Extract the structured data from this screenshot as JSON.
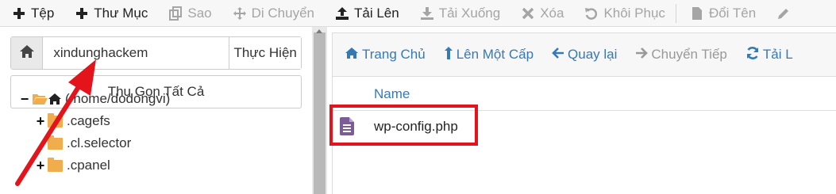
{
  "toolbar": {
    "items": [
      {
        "label": "Tệp",
        "icon": "plus-icon",
        "state": "active"
      },
      {
        "label": "Thư Mục",
        "icon": "plus-icon",
        "state": "active"
      },
      {
        "label": "Sao",
        "icon": "copy-icon",
        "state": "disabled"
      },
      {
        "label": "Di Chuyển",
        "icon": "move-icon",
        "state": "disabled"
      },
      {
        "label": "Tải Lên",
        "icon": "upload-icon",
        "state": "active"
      },
      {
        "label": "Tải Xuống",
        "icon": "download-icon",
        "state": "disabled"
      },
      {
        "label": "Xóa",
        "icon": "close-icon",
        "state": "disabled"
      },
      {
        "label": "Khôi Phục",
        "icon": "undo-icon",
        "state": "disabled"
      },
      {
        "label": "Đổi Tên",
        "icon": "file-icon",
        "state": "disabled"
      }
    ]
  },
  "sidebar": {
    "path_value": "xindunghackem",
    "go_label": "Thực Hiện",
    "collapse_label": "Thu Gọn Tất Cả",
    "tree": [
      {
        "label": "(/home/dodongvi)",
        "toggle": "−",
        "type": "root"
      },
      {
        "label": ".cagefs",
        "toggle": "+",
        "type": "folder"
      },
      {
        "label": ".cl.selector",
        "toggle": "",
        "type": "folder"
      },
      {
        "label": ".cpanel",
        "toggle": "+",
        "type": "folder"
      }
    ]
  },
  "navbar": {
    "items": [
      {
        "label": "Trang Chủ",
        "icon": "home-icon",
        "state": "enabled"
      },
      {
        "label": "Lên Một Cấp",
        "icon": "level-up-icon",
        "state": "enabled"
      },
      {
        "label": "Quay lại",
        "icon": "arrow-left-icon",
        "state": "enabled"
      },
      {
        "label": "Chuyển Tiếp",
        "icon": "arrow-right-icon",
        "state": "disabled"
      },
      {
        "label": "Tải L",
        "icon": "refresh-icon",
        "state": "enabled"
      }
    ]
  },
  "table": {
    "column_name": "Name",
    "files": [
      {
        "name": "wp-config.php",
        "icon": "text-file-icon"
      }
    ]
  },
  "colors": {
    "link": "#337ab7",
    "annotation": "#e3141b",
    "folder": "#f0ad4e",
    "file_icon": "#7b5c96"
  }
}
